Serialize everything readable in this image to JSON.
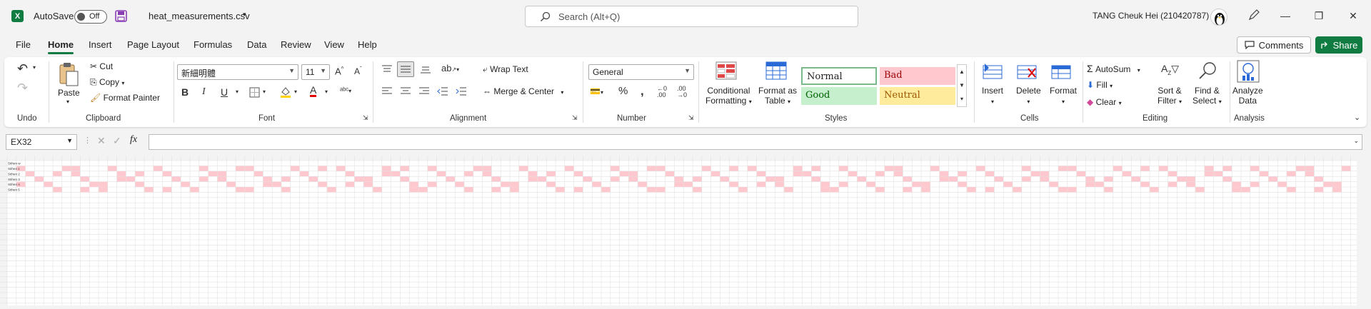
{
  "app": {
    "autosave_label": "AutoSave",
    "autosave_state": "Off",
    "filename": "heat_measurements.csv",
    "search_placeholder": "Search (Alt+Q)",
    "user_name": "TANG Cheuk Hei (210420787)",
    "brand_color": "#107c41"
  },
  "menu": [
    "File",
    "Home",
    "Insert",
    "Page Layout",
    "Formulas",
    "Data",
    "Review",
    "View",
    "Help"
  ],
  "menu_active": "Home",
  "header_buttons": {
    "comments": "Comments",
    "share": "Share"
  },
  "ribbon": {
    "groups": {
      "undo": "Undo",
      "clipboard": "Clipboard",
      "font": "Font",
      "alignment": "Alignment",
      "number": "Number",
      "styles": "Styles",
      "cells": "Cells",
      "editing": "Editing",
      "analysis": "Analysis"
    },
    "clipboard": {
      "paste": "Paste",
      "cut": "Cut",
      "copy": "Copy",
      "format_painter": "Format Painter"
    },
    "font": {
      "name": "新細明體",
      "size": "11"
    },
    "alignment": {
      "wrap_text": "Wrap Text",
      "merge_center": "Merge & Center"
    },
    "number": {
      "format": "General"
    },
    "styles": {
      "conditional_1": "Conditional",
      "conditional_2": "Formatting",
      "format_table_1": "Format as",
      "format_table_2": "Table",
      "normal": "Normal",
      "bad": "Bad",
      "good": "Good",
      "neutral": "Neutral"
    },
    "cells": {
      "insert": "Insert",
      "delete": "Delete",
      "format": "Format"
    },
    "editing": {
      "autosum": "AutoSum",
      "fill": "Fill",
      "clear": "Clear",
      "sort_1": "Sort &",
      "sort_2": "Filter",
      "find_1": "Find &",
      "find_2": "Select"
    },
    "analysis": {
      "analyze_1": "Analyze",
      "analyze_2": "Data"
    }
  },
  "formula_bar": {
    "name_box": "EX32",
    "formula": ""
  },
  "sheet": {
    "row_labels": [
      "Stihen w",
      "Stihen 1",
      "Stihen 2",
      "Stihen 3",
      "Stihen 4",
      "Stihen 5"
    ],
    "highlight_fill": "#ffc7ce",
    "highlight_text": "#9c0006",
    "grid_color": "#e1e1e1"
  }
}
